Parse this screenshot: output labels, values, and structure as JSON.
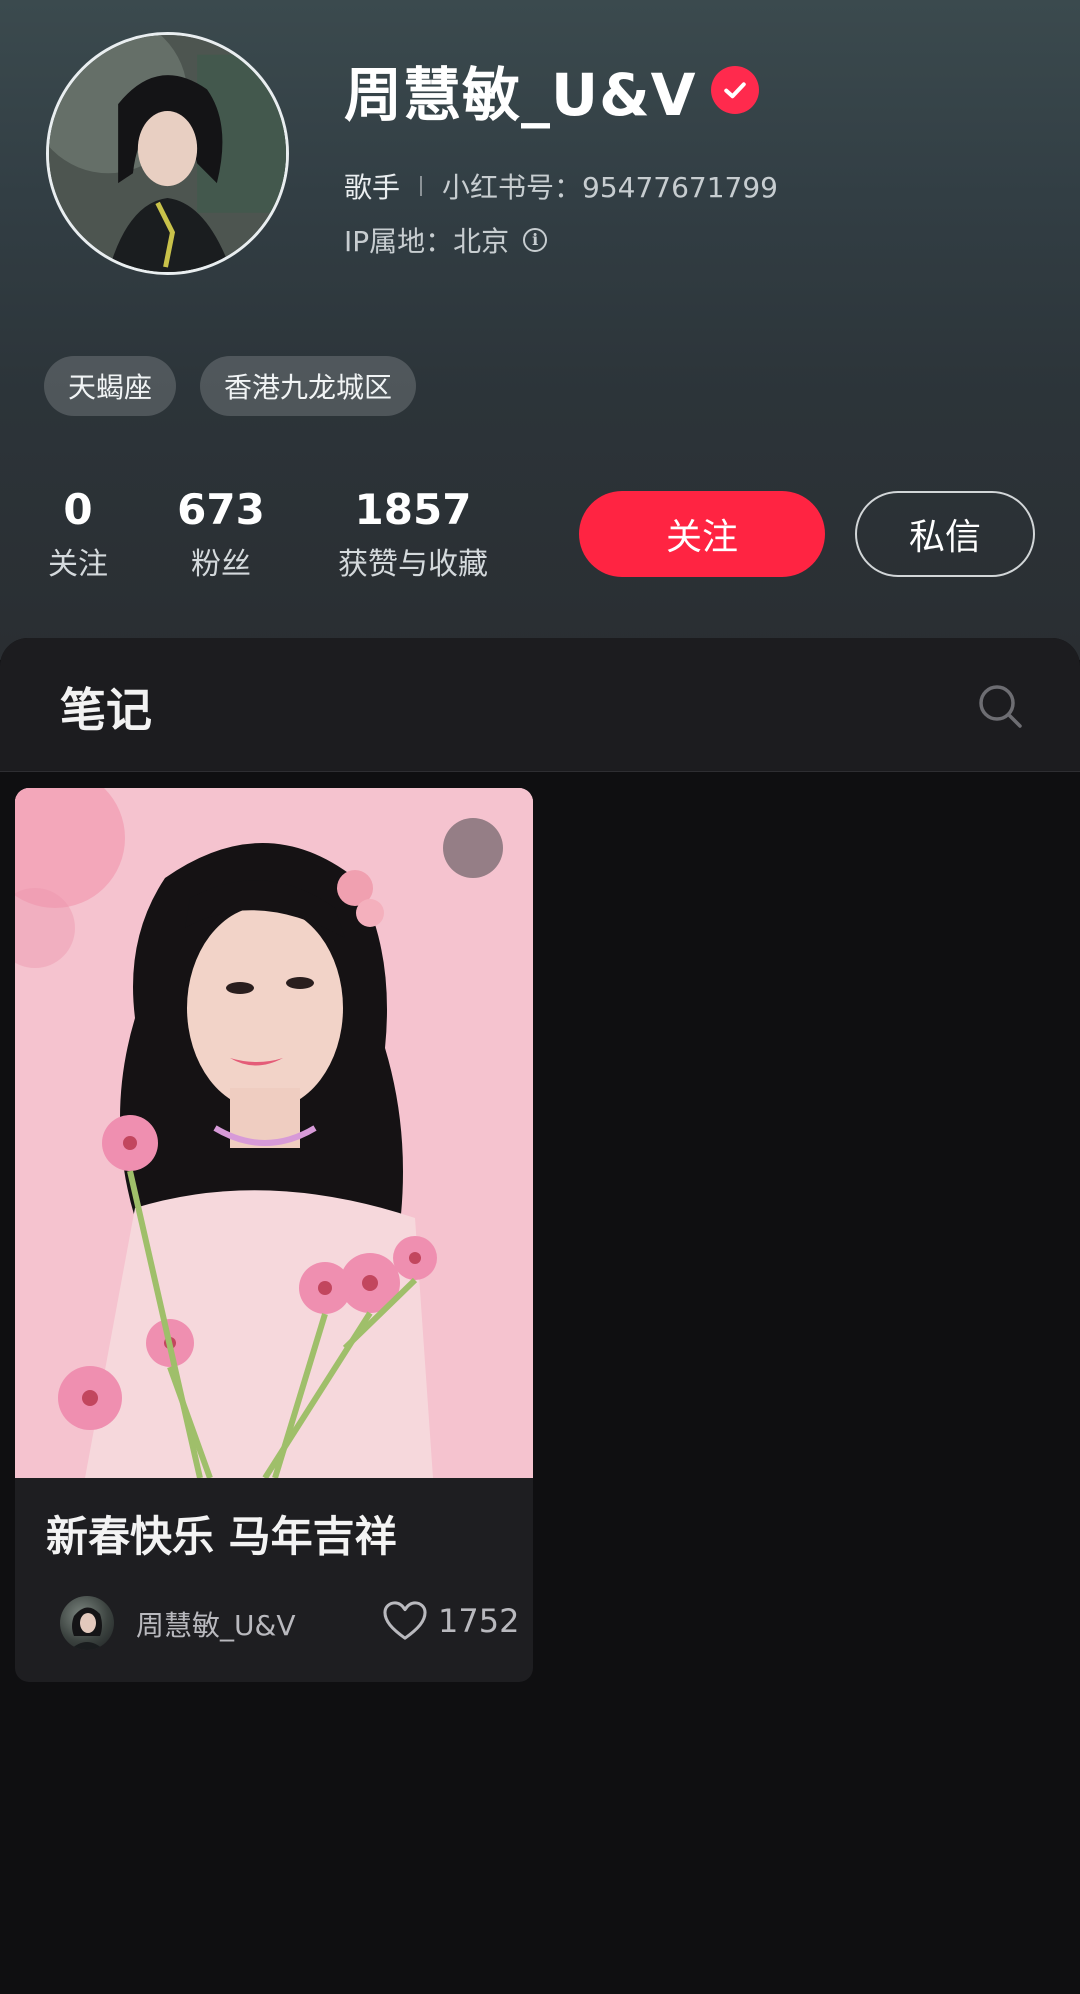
{
  "profile": {
    "name": "周慧敏_U&V",
    "verified_icon": "verified-check-icon",
    "occupation": "歌手",
    "red_id": "小红书号：95477671799",
    "ip_location": "IP属地：北京",
    "info_icon": "info-circle-icon",
    "tags": [
      "天蝎座",
      "香港九龙城区"
    ]
  },
  "stats": [
    {
      "value": "0",
      "label": "关注"
    },
    {
      "value": "673",
      "label": "粉丝"
    },
    {
      "value": "1857",
      "label": "获赞与收藏"
    }
  ],
  "actions": {
    "follow": "关注",
    "message": "私信"
  },
  "notes": {
    "tab_title": "笔记",
    "search_icon": "search-icon",
    "items": [
      {
        "title": "新春快乐 马年吉祥",
        "author": "周慧敏_U&V",
        "likes": "1752",
        "is_video": true
      }
    ]
  },
  "colors": {
    "accent": "#ff2442",
    "background": "#0f0f11",
    "card": "#1e1e21"
  }
}
